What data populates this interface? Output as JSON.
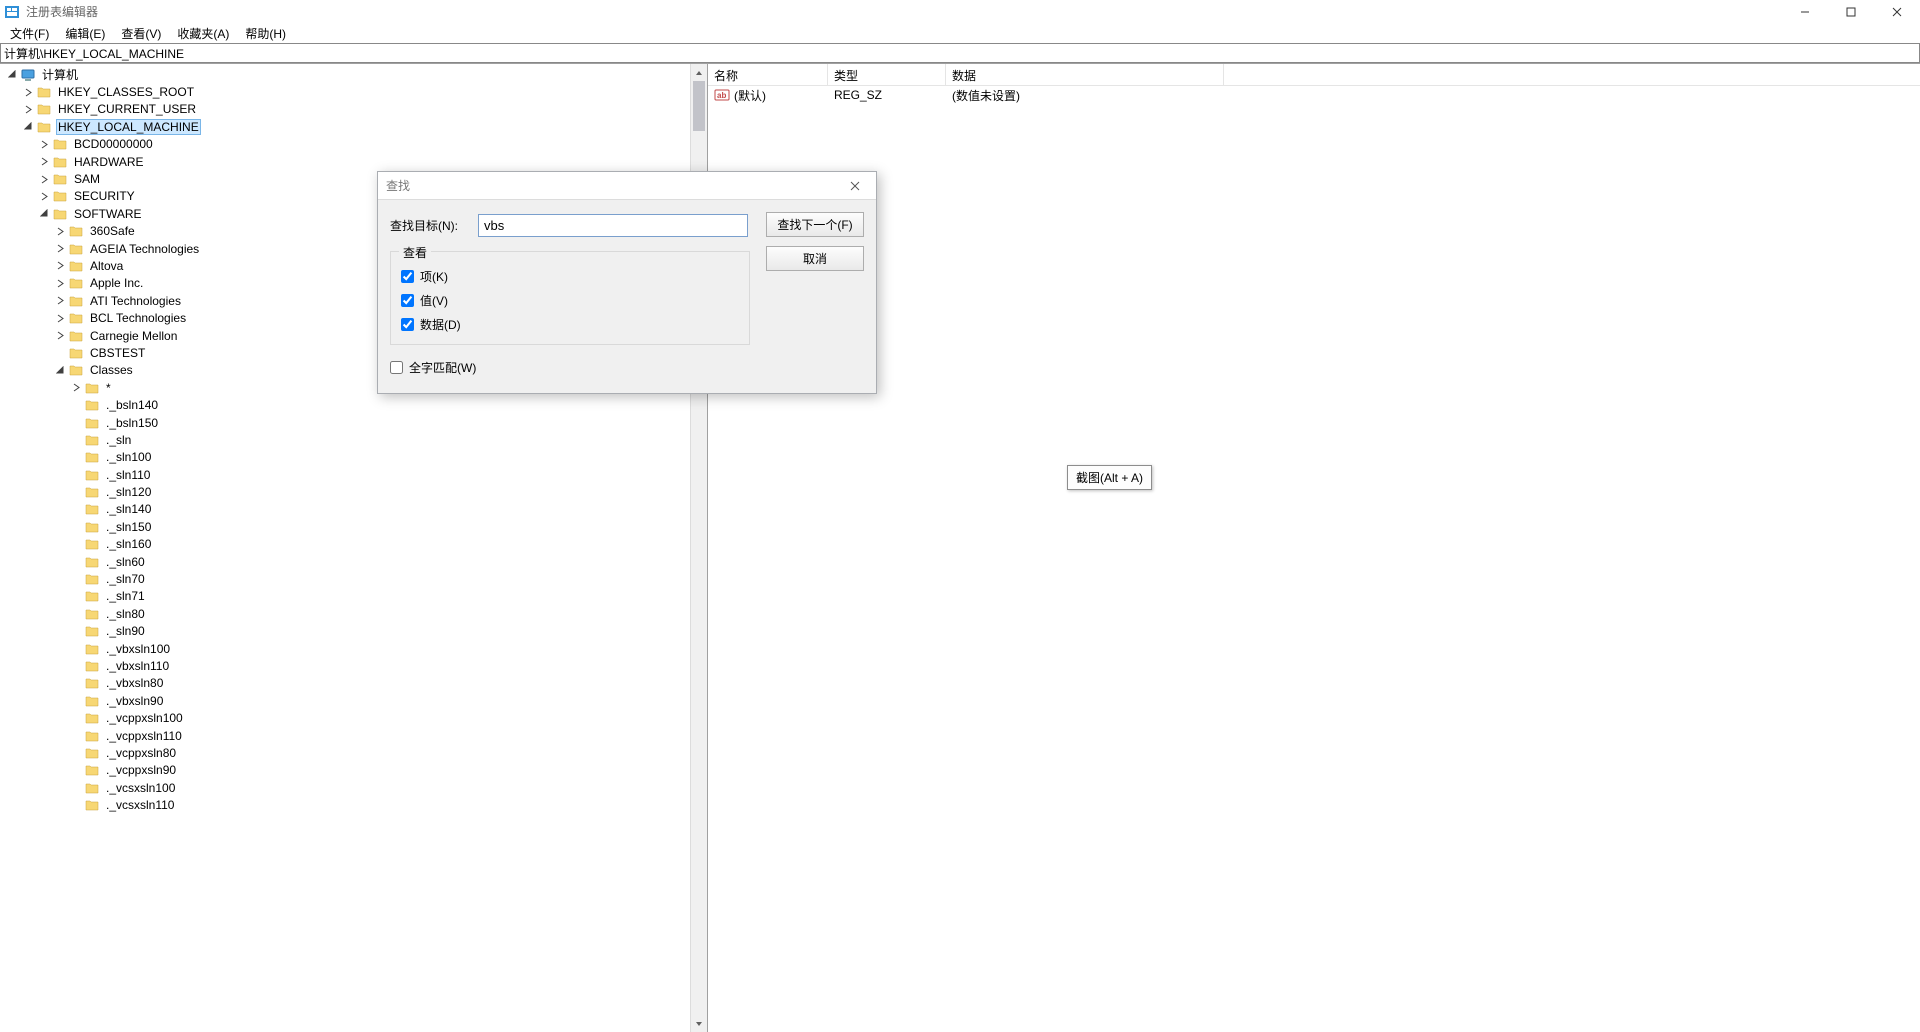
{
  "window": {
    "title": "注册表编辑器"
  },
  "menu": {
    "file": "文件(F)",
    "edit": "编辑(E)",
    "view": "查看(V)",
    "favorites": "收藏夹(A)",
    "help": "帮助(H)"
  },
  "address": "计算机\\HKEY_LOCAL_MACHINE",
  "tree": {
    "root": "计算机",
    "hives": {
      "hkcr": "HKEY_CLASSES_ROOT",
      "hkcu": "HKEY_CURRENT_USER",
      "hklm": "HKEY_LOCAL_MACHINE"
    },
    "hklm_children": {
      "bcd": "BCD00000000",
      "hardware": "HARDWARE",
      "sam": "SAM",
      "security": "SECURITY",
      "software": "SOFTWARE"
    },
    "software_children": [
      "360Safe",
      "AGEIA Technologies",
      "Altova",
      "Apple Inc.",
      "ATI Technologies",
      "BCL Technologies",
      "Carnegie Mellon",
      "CBSTEST",
      "Classes"
    ],
    "classes_star": "*",
    "classes_children": [
      "._bsln140",
      "._bsln150",
      "._sln",
      "._sln100",
      "._sln110",
      "._sln120",
      "._sln140",
      "._sln150",
      "._sln160",
      "._sln60",
      "._sln70",
      "._sln71",
      "._sln80",
      "._sln90",
      "._vbxsln100",
      "._vbxsln110",
      "._vbxsln80",
      "._vbxsln90",
      "._vcppxsln100",
      "._vcppxsln110",
      "._vcppxsln80",
      "._vcppxsln90",
      "._vcsxsln100",
      "._vcsxsln110"
    ]
  },
  "listview": {
    "cols": {
      "name": "名称",
      "type": "类型",
      "data": "数据"
    },
    "rows": [
      {
        "name": "(默认)",
        "type": "REG_SZ",
        "data": "(数值未设置)"
      }
    ]
  },
  "find_dialog": {
    "title": "查找",
    "label_target": "查找目标(N):",
    "value": "vbs",
    "group_title": "查看",
    "chk_keys": "项(K)",
    "chk_values": "值(V)",
    "chk_data": "数据(D)",
    "chk_whole": "全字匹配(W)",
    "btn_find": "查找下一个(F)",
    "btn_cancel": "取消"
  },
  "hint": "截图(Alt + A)"
}
